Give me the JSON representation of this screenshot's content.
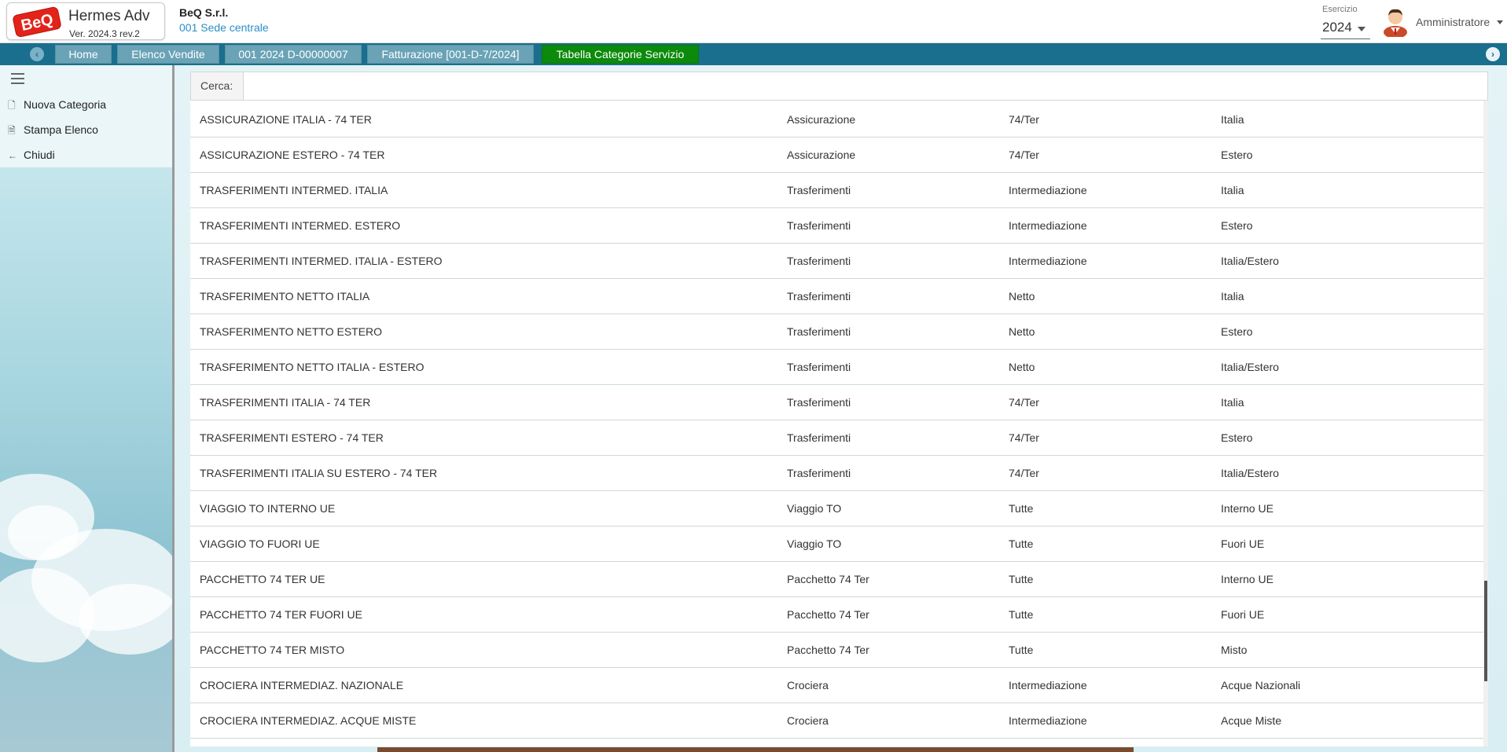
{
  "app": {
    "logo_text": "BeQ",
    "name": "Hermes Adv",
    "version": "Ver. 2024.3 rev.2",
    "company": "BeQ S.r.l.",
    "branch": "001 Sede centrale"
  },
  "esercizio": {
    "label": "Esercizio",
    "value": "2024"
  },
  "user": {
    "name": "Amministratore"
  },
  "tabs": [
    {
      "label": "Home",
      "active": false
    },
    {
      "label": "Elenco Vendite",
      "active": false
    },
    {
      "label": "001 2024 D-00000007",
      "active": false
    },
    {
      "label": "Fatturazione [001-D-7/2024]",
      "active": false
    },
    {
      "label": "Tabella Categorie Servizio",
      "active": true
    }
  ],
  "sidebar": {
    "items": [
      {
        "label": "Nuova Categoria",
        "icon": "document-icon"
      },
      {
        "label": "Stampa Elenco",
        "icon": "print-document-icon"
      },
      {
        "label": "Chiudi",
        "icon": "arrow-left-icon"
      }
    ]
  },
  "search": {
    "label": "Cerca:",
    "value": ""
  },
  "table": {
    "rows": [
      [
        "ASSICURAZIONE ITALIA - 74 TER",
        "Assicurazione",
        "74/Ter",
        "Italia"
      ],
      [
        "ASSICURAZIONE ESTERO - 74 TER",
        "Assicurazione",
        "74/Ter",
        "Estero"
      ],
      [
        "TRASFERIMENTI INTERMED. ITALIA",
        "Trasferimenti",
        "Intermediazione",
        "Italia"
      ],
      [
        "TRASFERIMENTI INTERMED. ESTERO",
        "Trasferimenti",
        "Intermediazione",
        "Estero"
      ],
      [
        "TRASFERIMENTI INTERMED. ITALIA - ESTERO",
        "Trasferimenti",
        "Intermediazione",
        "Italia/Estero"
      ],
      [
        "TRASFERIMENTO NETTO ITALIA",
        "Trasferimenti",
        "Netto",
        "Italia"
      ],
      [
        "TRASFERIMENTO NETTO ESTERO",
        "Trasferimenti",
        "Netto",
        "Estero"
      ],
      [
        "TRASFERIMENTO NETTO ITALIA - ESTERO",
        "Trasferimenti",
        "Netto",
        "Italia/Estero"
      ],
      [
        "TRASFERIMENTI ITALIA - 74 TER",
        "Trasferimenti",
        "74/Ter",
        "Italia"
      ],
      [
        "TRASFERIMENTI ESTERO - 74 TER",
        "Trasferimenti",
        "74/Ter",
        "Estero"
      ],
      [
        "TRASFERIMENTI ITALIA SU ESTERO - 74 TER",
        "Trasferimenti",
        "74/Ter",
        "Italia/Estero"
      ],
      [
        "VIAGGIO TO INTERNO UE",
        "Viaggio TO",
        "Tutte",
        "Interno UE"
      ],
      [
        "VIAGGIO TO FUORI UE",
        "Viaggio TO",
        "Tutte",
        "Fuori UE"
      ],
      [
        "PACCHETTO 74 TER UE",
        "Pacchetto 74 Ter",
        "Tutte",
        "Interno UE"
      ],
      [
        "PACCHETTO 74 TER FUORI UE",
        "Pacchetto 74 Ter",
        "Tutte",
        "Fuori UE"
      ],
      [
        "PACCHETTO 74 TER MISTO",
        "Pacchetto 74 Ter",
        "Tutte",
        "Misto"
      ],
      [
        "CROCIERA INTERMEDIAZ. NAZIONALE",
        "Crociera",
        "Intermediazione",
        "Acque Nazionali"
      ],
      [
        "CROCIERA INTERMEDIAZ. ACQUE MISTE",
        "Crociera",
        "Intermediazione",
        "Acque Miste"
      ]
    ]
  },
  "colors": {
    "tabbar": "#1a6e8e",
    "tab": "#6aa3b6",
    "tab_active": "#0b8a0b",
    "branch_link": "#2a8fc7"
  }
}
